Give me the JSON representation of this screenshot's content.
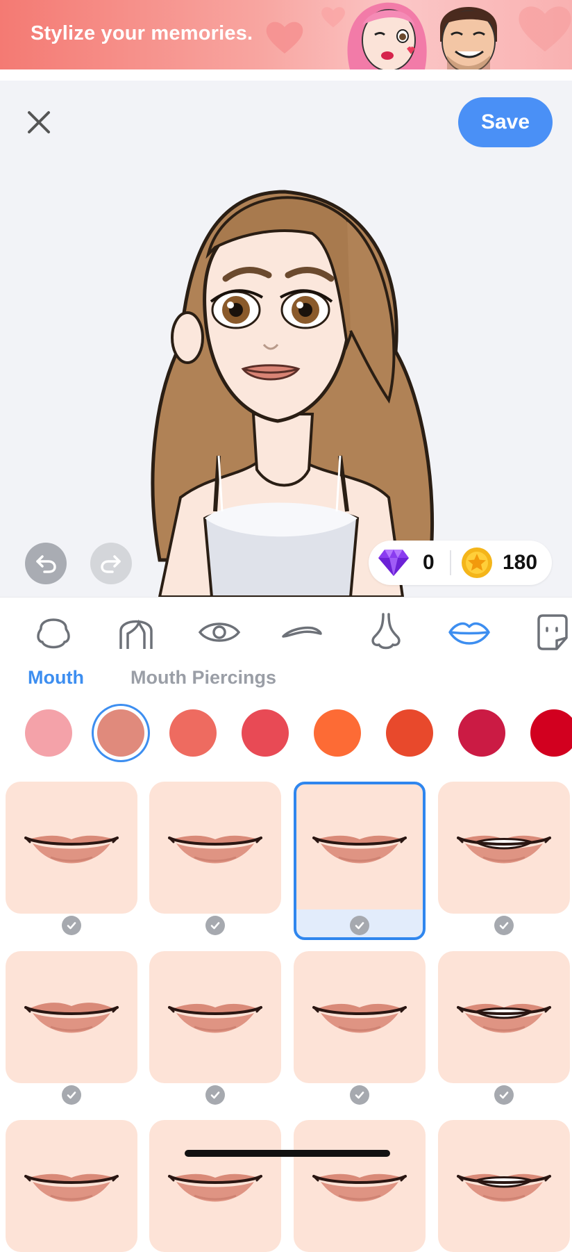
{
  "banner": {
    "text": "Stylize your memories."
  },
  "editor": {
    "save_label": "Save",
    "close_icon": "close-icon",
    "undo_icon": "undo-icon",
    "redo_icon": "redo-icon"
  },
  "currency": {
    "gems": "0",
    "coins": "180"
  },
  "categories": [
    {
      "name": "face",
      "icon": "face-shape-icon"
    },
    {
      "name": "hair",
      "icon": "hair-icon"
    },
    {
      "name": "eyes",
      "icon": "eye-icon"
    },
    {
      "name": "eyebrows",
      "icon": "eyebrow-icon"
    },
    {
      "name": "nose",
      "icon": "nose-icon"
    },
    {
      "name": "mouth",
      "icon": "lips-icon",
      "active": true
    },
    {
      "name": "more",
      "icon": "sticker-icon"
    }
  ],
  "subtabs": {
    "active": "Mouth",
    "inactive": "Mouth Piercings"
  },
  "colors": {
    "accent": "#4a90f6",
    "swatches": [
      "#f4a2a9",
      "#e08a7c",
      "#ee6b60",
      "#e84a55",
      "#fd6b35",
      "#e8492c",
      "#cb1b44",
      "#d2001f"
    ],
    "selected_swatch": "#e08a7c"
  },
  "mouth_styles": {
    "selected_index": 2,
    "count_visible": 12
  }
}
